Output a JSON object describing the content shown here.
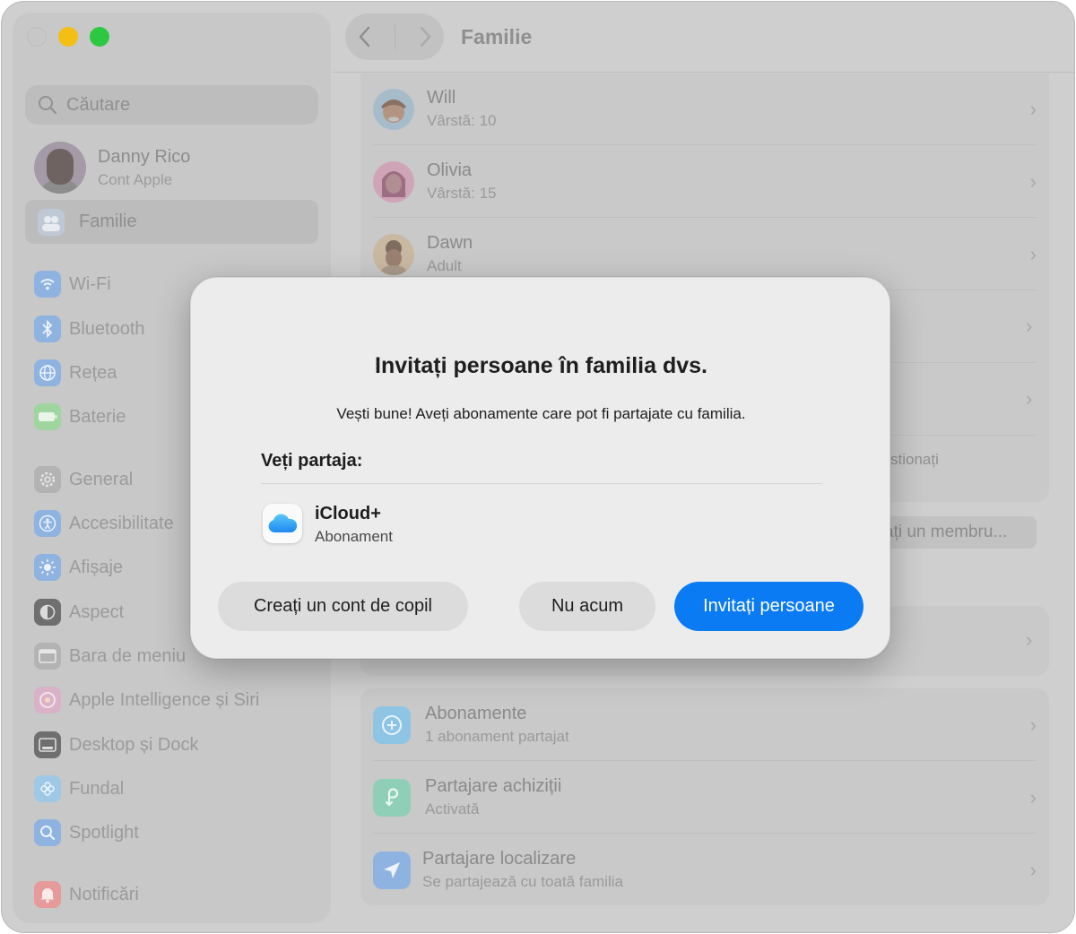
{
  "sidebar": {
    "search_placeholder": "Căutare",
    "account": {
      "name": "Danny Rico",
      "subtitle": "Cont Apple"
    },
    "selected": {
      "label": "Familie"
    },
    "items": [
      {
        "label": "Wi-Fi",
        "icon": "wifi-icon",
        "color": "#8fb3e0"
      },
      {
        "label": "Bluetooth",
        "icon": "bluetooth-icon",
        "color": "#8fb3e0"
      },
      {
        "label": "Rețea",
        "icon": "globe-icon",
        "color": "#8fb3e0"
      },
      {
        "label": "Baterie",
        "icon": "battery-icon",
        "color": "#9fd59f"
      },
      {
        "label": "General",
        "icon": "gear-icon",
        "color": "#b3b3b3"
      },
      {
        "label": "Accesibilitate",
        "icon": "accessibility-icon",
        "color": "#8fb3e0"
      },
      {
        "label": "Afișaje",
        "icon": "sun-icon",
        "color": "#8fb3e0"
      },
      {
        "label": "Aspect",
        "icon": "appearance-icon",
        "color": "#6f6f6f"
      },
      {
        "label": "Bara de meniu",
        "icon": "menubar-icon",
        "color": "#b3b3b3"
      },
      {
        "label": "Apple Intelligence și Siri",
        "icon": "siri-icon",
        "color": "#d9b2c8"
      },
      {
        "label": "Desktop și Dock",
        "icon": "dock-icon",
        "color": "#6f6f6f"
      },
      {
        "label": "Fundal",
        "icon": "wallpaper-icon",
        "color": "#9ec8e6"
      },
      {
        "label": "Spotlight",
        "icon": "spotlight-icon",
        "color": "#8fb3e0"
      },
      {
        "label": "Notificări",
        "icon": "bell-icon",
        "color": "#e69a9a"
      }
    ]
  },
  "header": {
    "title": "Familie"
  },
  "members": [
    {
      "name": "Will",
      "detail": "Vârstă: 10"
    },
    {
      "name": "Olivia",
      "detail": "Vârstă: 15"
    },
    {
      "name": "Dawn",
      "detail": "Adult"
    }
  ],
  "partial_text": "stionați",
  "add_member_label": "ați un membru...",
  "features": [
    {
      "title": "Abonamente",
      "detail": "1 abonament partajat",
      "icon": "subscriptions-icon",
      "color": "#8ec4e4"
    },
    {
      "title": "Partajare achiziții",
      "detail": "Activată",
      "icon": "purchase-sharing-icon",
      "color": "#8fcfb8"
    },
    {
      "title": "Partajare localizare",
      "detail": "Se partajează cu toată familia",
      "icon": "location-icon",
      "color": "#8fb3e0"
    }
  ],
  "dialog": {
    "title": "Invitați persoane în familia dvs.",
    "subtitle": "Vești bune! Aveți abonamente care pot fi partajate cu familia.",
    "share_heading": "Veți partaja:",
    "service": {
      "name": "iCloud+",
      "type": "Abonament"
    },
    "buttons": {
      "child": "Creați un cont de copil",
      "later": "Nu acum",
      "invite": "Invitați persoane"
    },
    "accent": "#0b7bf4"
  }
}
